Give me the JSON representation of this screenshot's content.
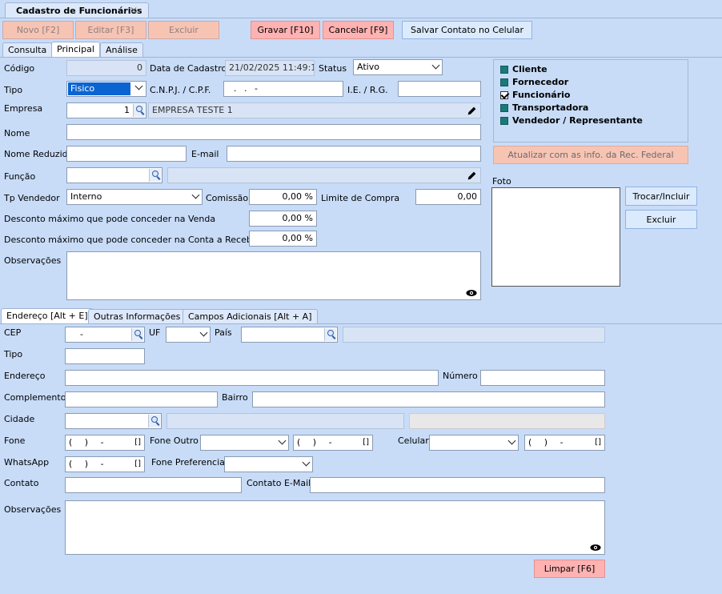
{
  "window": {
    "title": "Cadastro de Funcionários"
  },
  "toolbar": {
    "novo": "Novo [F2]",
    "editar": "Editar [F3]",
    "excluir": "Excluir",
    "gravar": "Gravar [F10]",
    "cancelar": "Cancelar [F9]",
    "salvar_contato": "Salvar Contato no Celular"
  },
  "tabs": [
    "Consulta",
    "Principal",
    "Análise"
  ],
  "form": {
    "codigo_label": "Código",
    "codigo_value": "0",
    "data_cadastro_label": "Data de Cadastro",
    "data_cadastro_value": "21/02/2025 11:49:14",
    "status_label": "Status",
    "status_value": "Ativo",
    "tipo_label": "Tipo",
    "tipo_value": "Fisico",
    "cnpj_label": "C.N.P.J. / C.P.F.",
    "cnpj_value": ". . -",
    "ie_label": "I.E. / R.G.",
    "empresa_label": "Empresa",
    "empresa_code": "1",
    "empresa_name": "EMPRESA TESTE 1",
    "nome_label": "Nome",
    "nome_reduzido_label": "Nome Reduzido",
    "email_label": "E-mail",
    "funcao_label": "Função",
    "tp_vendedor_label": "Tp Vendedor",
    "tp_vendedor_value": "Interno",
    "comissao_label": "Comissão",
    "comissao_value": "0,00 %",
    "limite_label": "Limite de Compra",
    "limite_value": "0,00",
    "desc_venda_label": "Desconto máximo que pode conceder na Venda",
    "desc_venda_value": "0,00 %",
    "desc_conta_label": "Desconto máximo que pode conceder na Conta a Receber",
    "desc_conta_value": "0,00 %",
    "obs_label": "Observações"
  },
  "categories": [
    {
      "label": "Cliente",
      "checked": false
    },
    {
      "label": "Fornecedor",
      "checked": false
    },
    {
      "label": "Funcionário",
      "checked": true
    },
    {
      "label": "Transportadora",
      "checked": false
    },
    {
      "label": "Vendedor / Representante",
      "checked": false
    }
  ],
  "atualizar_btn": "Atualizar com as info. da Rec. Federal",
  "foto": {
    "label": "Foto",
    "trocar": "Trocar/Incluir",
    "excluir": "Excluir"
  },
  "addr_tabs": [
    "Endereço [Alt + E]",
    "Outras Informações",
    "Campos Adicionais [Alt + A]"
  ],
  "addr": {
    "cep_label": "CEP",
    "cep_value": "-",
    "uf_label": "UF",
    "pais_label": "País",
    "tipo_label": "Tipo",
    "endereco_label": "Endereço",
    "numero_label": "Número",
    "complemento_label": "Complemento",
    "bairro_label": "Bairro",
    "cidade_label": "Cidade",
    "fone_label": "Fone",
    "fone_value": "( ) -",
    "fone_outro_label": "Fone Outro",
    "fone_outro_value": "( ) -",
    "celular_label": "Celular",
    "celular_value": "( ) -",
    "whatsapp_label": "WhatsApp",
    "whatsapp_value": "( ) -",
    "fone_pref_label": "Fone Preferencial",
    "contato_label": "Contato",
    "contato_email_label": "Contato E-Mail",
    "obs_label": "Observações"
  },
  "limpar_btn": "Limpar [F6]",
  "colors": {
    "background": "#c8dcf8",
    "action_button": "#f7c4b4",
    "checkbox": "#1a7a7a"
  }
}
